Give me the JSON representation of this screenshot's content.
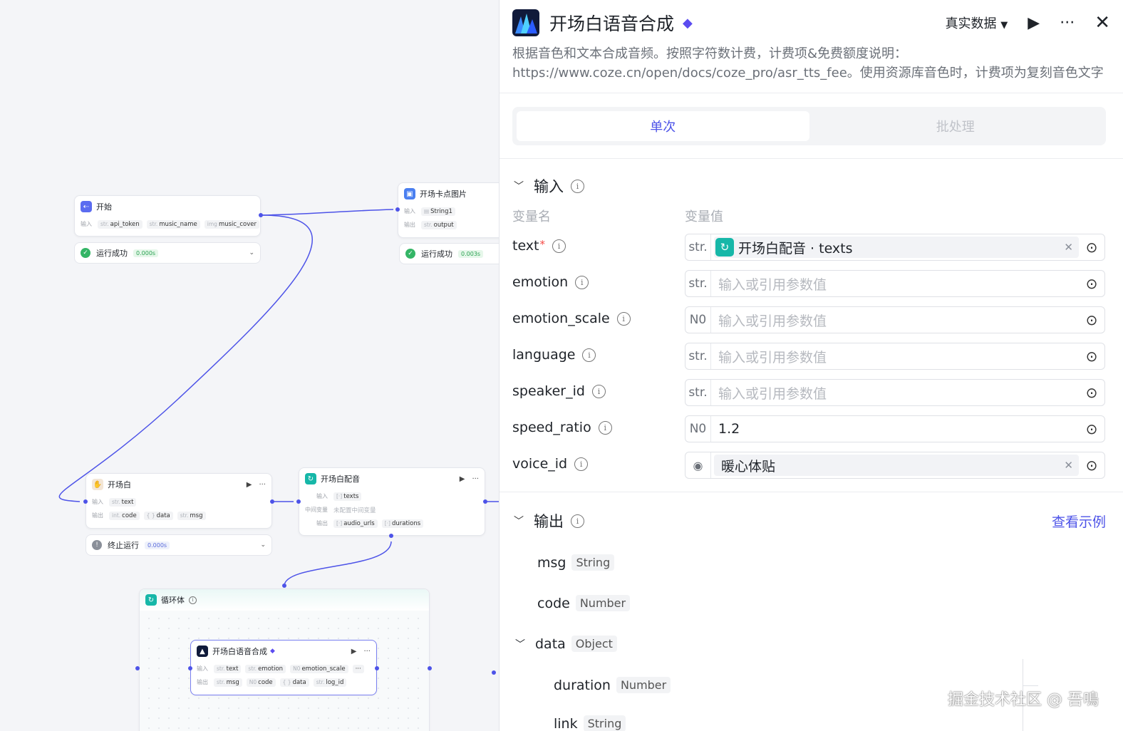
{
  "canvas": {
    "start_node": {
      "title": "开始",
      "in_label": "输入",
      "params": [
        {
          "t": "str.",
          "n": "api_token"
        },
        {
          "t": "str.",
          "n": "music_name"
        },
        {
          "t": "img",
          "n": "music_cover"
        }
      ],
      "status": "运行成功",
      "time": "0.000s"
    },
    "card_node": {
      "title": "开场卡点图片",
      "in_label": "输入",
      "out_label": "输出",
      "input": "String1",
      "output": "output",
      "status": "运行成功",
      "time": "0.003s"
    },
    "intro_node": {
      "title": "开场白",
      "in_label": "输入",
      "out_label": "输出",
      "input": "text",
      "outputs": [
        {
          "t": "int.",
          "n": "code"
        },
        {
          "t": "{ }",
          "n": "data"
        },
        {
          "t": "str.",
          "n": "msg"
        }
      ],
      "status": "终止运行",
      "time": "0.000s"
    },
    "dub_node": {
      "title": "开场白配音",
      "in_label": "输入",
      "mid_label": "中间变量",
      "mid_value": "未配置中间变量",
      "out_label": "输出",
      "input": "texts",
      "outputs": [
        {
          "t": "list",
          "n": "audio_urls"
        },
        {
          "t": "list",
          "n": "durations"
        }
      ]
    },
    "loop_node": {
      "title": "循环体"
    },
    "tts_node": {
      "title": "开场白语音合成",
      "in_label": "输入",
      "out_label": "输出",
      "inputs": [
        {
          "t": "str.",
          "n": "text"
        },
        {
          "t": "str.",
          "n": "emotion"
        },
        {
          "t": "N0",
          "n": "emotion_scale"
        }
      ],
      "outputs": [
        {
          "t": "str.",
          "n": "msg"
        },
        {
          "t": "N0",
          "n": "code"
        },
        {
          "t": "{ }",
          "n": "data"
        },
        {
          "t": "str.",
          "n": "log_id"
        }
      ]
    }
  },
  "panel": {
    "title": "开场白语音合成",
    "data_mode": "真实数据",
    "description": "根据音色和文本合成音频。按照字符数计费，计费项&免费额度说明：https://www.coze.cn/open/docs/coze_pro/asr_tts_fee。使用资源库音色时，计费项为复刻音色文字转语音字数；使用预设…",
    "tabs": {
      "single": "单次",
      "batch": "批处理"
    },
    "input_title": "输入",
    "col_name": "变量名",
    "col_value": "变量值",
    "params": [
      {
        "name": "text",
        "type": "str.",
        "value": "开场白配音 · texts"
      },
      {
        "name": "emotion",
        "type": "str.",
        "placeholder": "输入或引用参数值"
      },
      {
        "name": "emotion_scale",
        "type": "N0",
        "placeholder": "输入或引用参数值"
      },
      {
        "name": "language",
        "type": "str.",
        "placeholder": "输入或引用参数值"
      },
      {
        "name": "speaker_id",
        "type": "str.",
        "placeholder": "输入或引用参数值"
      },
      {
        "name": "speed_ratio",
        "type": "N0",
        "value": "1.2"
      },
      {
        "name": "voice_id",
        "type": "voice",
        "value": "暖心体贴"
      }
    ],
    "output_title": "输出",
    "view_example": "查看示例",
    "outputs": [
      {
        "name": "msg",
        "type": "String"
      },
      {
        "name": "code",
        "type": "Number"
      },
      {
        "name": "data",
        "type": "Object"
      },
      {
        "name": "duration",
        "type": "Number"
      },
      {
        "name": "link",
        "type": "String"
      }
    ]
  },
  "watermark": "掘金技术社区 @ 吾鳴"
}
